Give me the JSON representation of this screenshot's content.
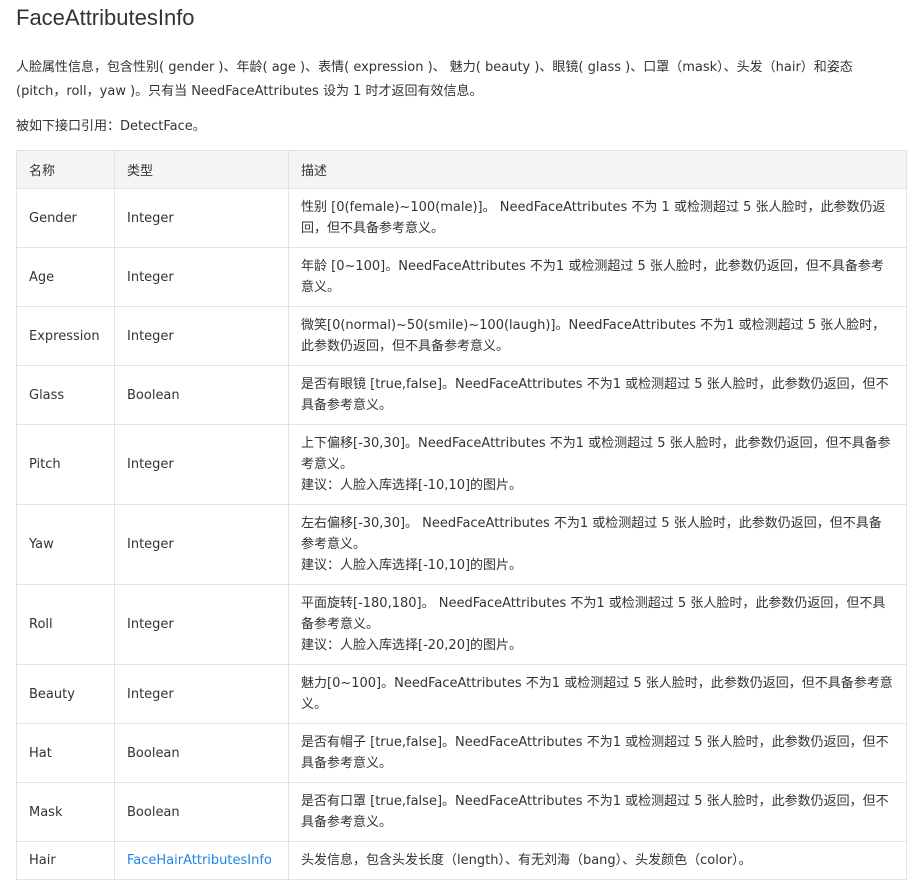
{
  "title": "FaceAttributesInfo",
  "intro": "人脸属性信息，包含性别( gender )、年龄( age )、表情( expression )、 魅力( beauty )、眼镜( glass )、口罩（mask）、头发（hair）和姿态 (pitch，roll，yaw )。只有当 NeedFaceAttributes 设为 1 时才返回有效信息。",
  "reference": "被如下接口引用：DetectFace。",
  "table": {
    "headers": [
      "名称",
      "类型",
      "描述"
    ],
    "rows": [
      {
        "name": "Gender",
        "type": "Integer",
        "link": false,
        "desc": [
          "性别 [0(female)~100(male)]。 NeedFaceAttributes 不为 1 或检测超过 5 张人脸时，此参数仍返回，但不具备参考意义。"
        ]
      },
      {
        "name": "Age",
        "type": "Integer",
        "link": false,
        "desc": [
          "年龄 [0~100]。NeedFaceAttributes 不为1 或检测超过 5 张人脸时，此参数仍返回，但不具备参考意义。"
        ]
      },
      {
        "name": "Expression",
        "type": "Integer",
        "link": false,
        "desc": [
          "微笑[0(normal)~50(smile)~100(laugh)]。NeedFaceAttributes 不为1 或检测超过 5 张人脸时，此参数仍返回，但不具备参考意义。"
        ]
      },
      {
        "name": "Glass",
        "type": "Boolean",
        "link": false,
        "desc": [
          "是否有眼镜 [true,false]。NeedFaceAttributes 不为1 或检测超过 5 张人脸时，此参数仍返回，但不具备参考意义。"
        ]
      },
      {
        "name": "Pitch",
        "type": "Integer",
        "link": false,
        "desc": [
          "上下偏移[-30,30]。NeedFaceAttributes 不为1 或检测超过 5 张人脸时，此参数仍返回，但不具备参考意义。",
          "建议：人脸入库选择[-10,10]的图片。"
        ]
      },
      {
        "name": "Yaw",
        "type": "Integer",
        "link": false,
        "desc": [
          "左右偏移[-30,30]。 NeedFaceAttributes 不为1 或检测超过 5 张人脸时，此参数仍返回，但不具备参考意义。",
          "建议：人脸入库选择[-10,10]的图片。"
        ]
      },
      {
        "name": "Roll",
        "type": "Integer",
        "link": false,
        "desc": [
          "平面旋转[-180,180]。 NeedFaceAttributes 不为1 或检测超过 5 张人脸时，此参数仍返回，但不具备参考意义。",
          "建议：人脸入库选择[-20,20]的图片。"
        ]
      },
      {
        "name": "Beauty",
        "type": "Integer",
        "link": false,
        "desc": [
          "魅力[0~100]。NeedFaceAttributes 不为1 或检测超过 5 张人脸时，此参数仍返回，但不具备参考意义。"
        ]
      },
      {
        "name": "Hat",
        "type": "Boolean",
        "link": false,
        "desc": [
          "是否有帽子 [true,false]。NeedFaceAttributes 不为1 或检测超过 5 张人脸时，此参数仍返回，但不具备参考意义。"
        ]
      },
      {
        "name": "Mask",
        "type": "Boolean",
        "link": false,
        "desc": [
          "是否有口罩 [true,false]。NeedFaceAttributes 不为1 或检测超过 5 张人脸时，此参数仍返回，但不具备参考意义。"
        ]
      },
      {
        "name": "Hair",
        "type": "FaceHairAttributesInfo",
        "link": true,
        "desc": [
          "头发信息，包含头发长度（length）、有无刘海（bang）、头发颜色（color）。"
        ]
      }
    ]
  },
  "colors": {
    "link": "#1f86e8",
    "header_bg": "#f4f4f4",
    "border": "#e3e3e3",
    "text": "#333333"
  }
}
